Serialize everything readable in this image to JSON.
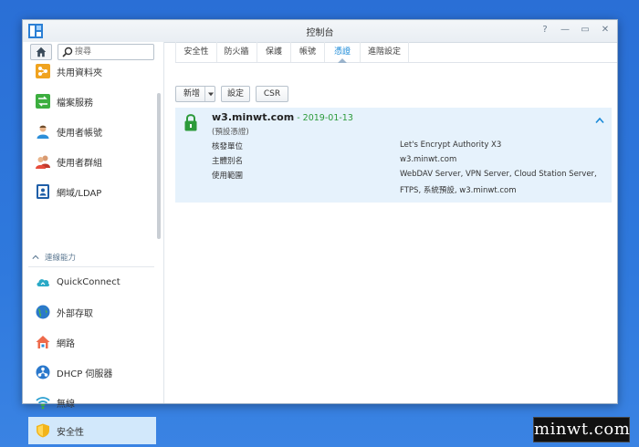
{
  "window": {
    "title": "控制台"
  },
  "search": {
    "placeholder": "搜尋"
  },
  "sidebar": {
    "items": [
      {
        "label": "共用資料夾"
      },
      {
        "label": "檔案服務"
      },
      {
        "label": "使用者帳號"
      },
      {
        "label": "使用者群組"
      },
      {
        "label": "網域/LDAP"
      }
    ],
    "section_label": "連線能力",
    "section_items": [
      {
        "label": "QuickConnect"
      },
      {
        "label": "外部存取"
      },
      {
        "label": "網路"
      },
      {
        "label": "DHCP 伺服器"
      },
      {
        "label": "無線"
      },
      {
        "label": "安全性"
      }
    ]
  },
  "tabs": [
    {
      "label": "安全性"
    },
    {
      "label": "防火牆"
    },
    {
      "label": "保護"
    },
    {
      "label": "帳號"
    },
    {
      "label": "憑證"
    },
    {
      "label": "進階設定"
    }
  ],
  "toolbar": {
    "add_label": "新增",
    "settings_label": "設定",
    "csr_label": "CSR"
  },
  "certificate": {
    "domain": "w3.minwt.com",
    "date": "2019-01-13",
    "subtitle": "(預設憑證)",
    "rows": [
      {
        "label": "核發單位",
        "value": "Let's Encrypt Authority X3"
      },
      {
        "label": "主體別名",
        "value": "w3.minwt.com"
      },
      {
        "label": "使用範圍",
        "value": "WebDAV Server, VPN Server, Cloud Station Server,",
        "value2": "FTPS, 系統預設, w3.minwt.com"
      }
    ]
  },
  "watermark": {
    "text": "minwt.com"
  },
  "colors": {
    "accent": "#1a8ad8",
    "active_bg": "#d2e8fb",
    "cert_bg": "#e6f2fc",
    "date_green": "#2c9a3a",
    "desktop": "#2f79dd"
  }
}
